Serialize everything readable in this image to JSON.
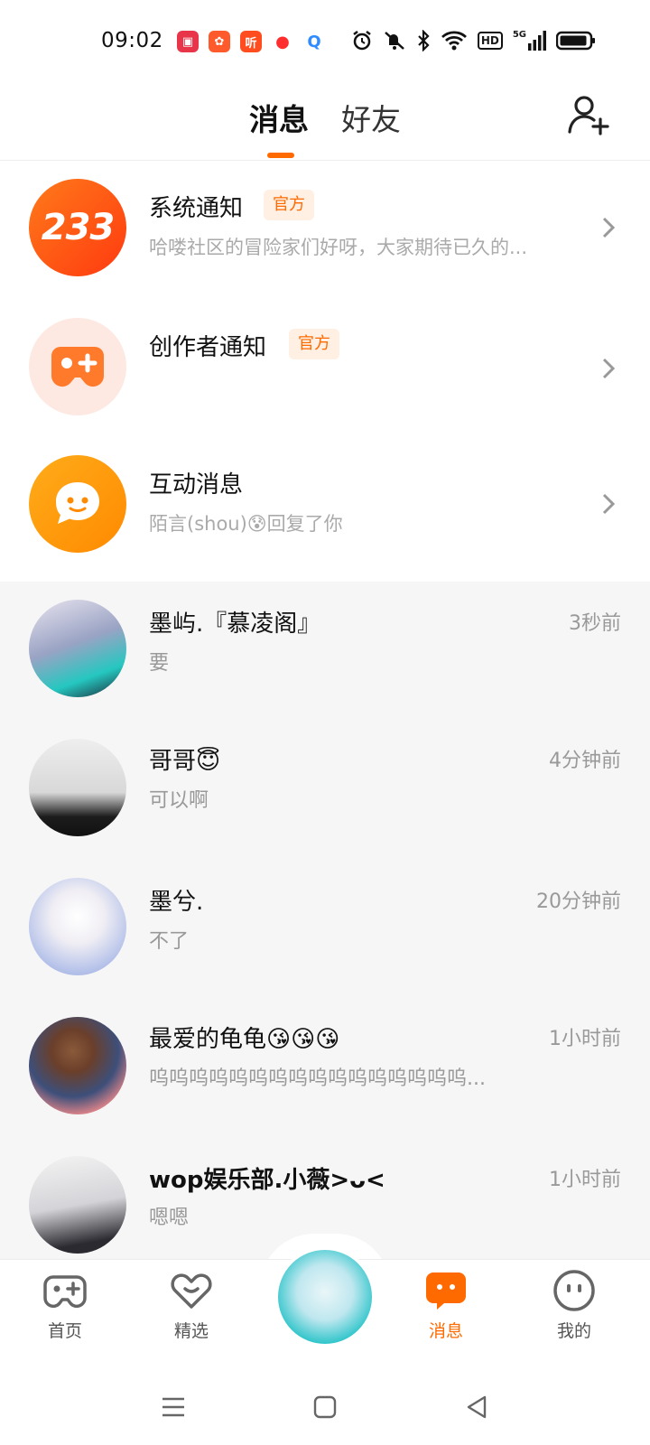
{
  "status_bar": {
    "time": "09:02",
    "app_icons": [
      {
        "icon": "video-app-icon",
        "color": "#e8354a",
        "glyph": "▣"
      },
      {
        "icon": "kuaishou-app-icon",
        "color": "#ff5a2c",
        "glyph": "✿"
      },
      {
        "icon": "listen-app-icon",
        "color": "#ff4d1f",
        "glyph": "听"
      },
      {
        "icon": "play-app-icon",
        "color": "#ff2d2d",
        "glyph": "▶"
      },
      {
        "icon": "q-app-icon",
        "color": "#2f8cff",
        "glyph": "Q"
      }
    ],
    "hd_label": "HD",
    "net_label": "5G"
  },
  "header": {
    "tab_messages": "消息",
    "tab_friends": "好友",
    "accent_color": "#ff6a00"
  },
  "official": [
    {
      "avatar_text": "233",
      "title": "系统通知",
      "badge": "官方",
      "subtitle": "哈喽社区的冒险家们好呀，大家期待已久的..."
    },
    {
      "title": "创作者通知",
      "badge": "官方",
      "subtitle": ""
    },
    {
      "title": "互动消息",
      "subtitle": "陌言(shou)😰回复了你"
    }
  ],
  "chats": [
    {
      "name": "墨屿.『慕凌阁』",
      "time": "3秒前",
      "message": "要"
    },
    {
      "name": "哥哥😇",
      "time": "4分钟前",
      "message": "可以啊"
    },
    {
      "name": "墨兮.",
      "time": "20分钟前",
      "message": "不了"
    },
    {
      "name": "最爱的龟龟😘😘😘",
      "time": "1小时前",
      "message": "呜呜呜呜呜呜呜呜呜呜呜呜呜呜呜呜..."
    },
    {
      "name": "wop娱乐部.小薇>ᴗ<",
      "time": "1小时前",
      "message": "嗯嗯"
    }
  ],
  "bottom_nav": [
    {
      "label": "首页"
    },
    {
      "label": "精选"
    },
    {
      "label": "消息",
      "active": true
    },
    {
      "label": "我的"
    }
  ]
}
